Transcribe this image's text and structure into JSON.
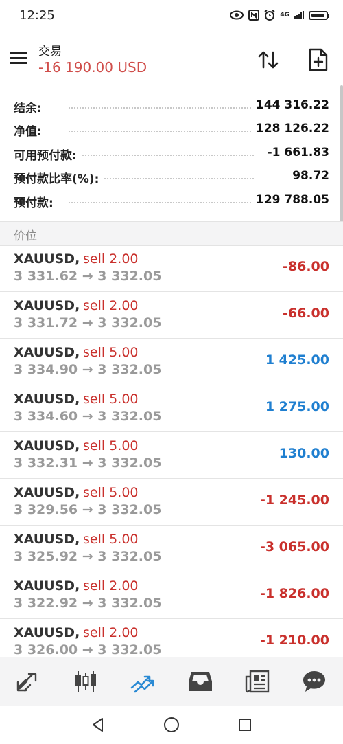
{
  "status": {
    "time": "12:25",
    "network": "4G"
  },
  "header": {
    "title": "交易",
    "balance_change": "-16 190.00 USD"
  },
  "summary": [
    {
      "label": "结余:",
      "value": "144 316.22"
    },
    {
      "label": "净值:",
      "value": "128 126.22"
    },
    {
      "label": "可用预付款:",
      "value": "-1 661.83"
    },
    {
      "label": "预付款比率(%):",
      "value": "98.72"
    },
    {
      "label": "预付款:",
      "value": "129 788.05"
    }
  ],
  "section": {
    "title": "价位"
  },
  "positions": [
    {
      "symbol": "XAUUSD,",
      "side": "sell 2.00",
      "prices": "3 331.62 → 3 332.05",
      "profit": "-86.00",
      "tone": "neg"
    },
    {
      "symbol": "XAUUSD,",
      "side": "sell 2.00",
      "prices": "3 331.72 → 3 332.05",
      "profit": "-66.00",
      "tone": "neg"
    },
    {
      "symbol": "XAUUSD,",
      "side": "sell 5.00",
      "prices": "3 334.90 → 3 332.05",
      "profit": "1 425.00",
      "tone": "pos"
    },
    {
      "symbol": "XAUUSD,",
      "side": "sell 5.00",
      "prices": "3 334.60 → 3 332.05",
      "profit": "1 275.00",
      "tone": "pos"
    },
    {
      "symbol": "XAUUSD,",
      "side": "sell 5.00",
      "prices": "3 332.31 → 3 332.05",
      "profit": "130.00",
      "tone": "pos"
    },
    {
      "symbol": "XAUUSD,",
      "side": "sell 5.00",
      "prices": "3 329.56 → 3 332.05",
      "profit": "-1 245.00",
      "tone": "neg"
    },
    {
      "symbol": "XAUUSD,",
      "side": "sell 5.00",
      "prices": "3 325.92 → 3 332.05",
      "profit": "-3 065.00",
      "tone": "neg"
    },
    {
      "symbol": "XAUUSD,",
      "side": "sell 2.00",
      "prices": "3 322.92 → 3 332.05",
      "profit": "-1 826.00",
      "tone": "neg"
    },
    {
      "symbol": "XAUUSD,",
      "side": "sell 2.00",
      "prices": "3 326.00 → 3 332.05",
      "profit": "-1 210.00",
      "tone": "neg"
    }
  ],
  "tabs": [
    {
      "icon": "quotes-icon"
    },
    {
      "icon": "chart-icon"
    },
    {
      "icon": "trade-icon",
      "active": true
    },
    {
      "icon": "history-icon"
    },
    {
      "icon": "news-icon"
    },
    {
      "icon": "messages-icon"
    }
  ],
  "colors": {
    "accent": "#1f7fd0",
    "loss": "#c9302c",
    "header_loss": "#d04e4b"
  }
}
